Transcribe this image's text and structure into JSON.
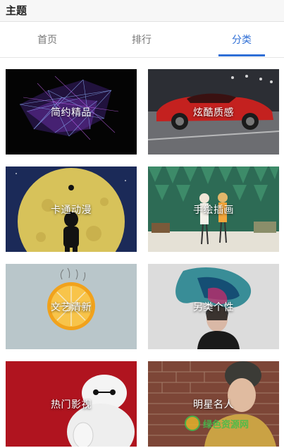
{
  "topbar": {
    "title": "主题"
  },
  "tabs": [
    {
      "label": "首页",
      "active": false
    },
    {
      "label": "排行",
      "active": false
    },
    {
      "label": "分类",
      "active": true
    }
  ],
  "categories": [
    {
      "label": "简约精品"
    },
    {
      "label": "炫酷质感"
    },
    {
      "label": "卡通动漫"
    },
    {
      "label": "手绘插画"
    },
    {
      "label": "文艺清新"
    },
    {
      "label": "另类个性"
    },
    {
      "label": "热门影视"
    },
    {
      "label": "明星名人"
    }
  ],
  "colors": {
    "accent": "#2f6fd6",
    "tab_inactive": "#777777",
    "watermark": "#3fbf4b"
  },
  "watermark": {
    "text": "绿色资源网"
  }
}
